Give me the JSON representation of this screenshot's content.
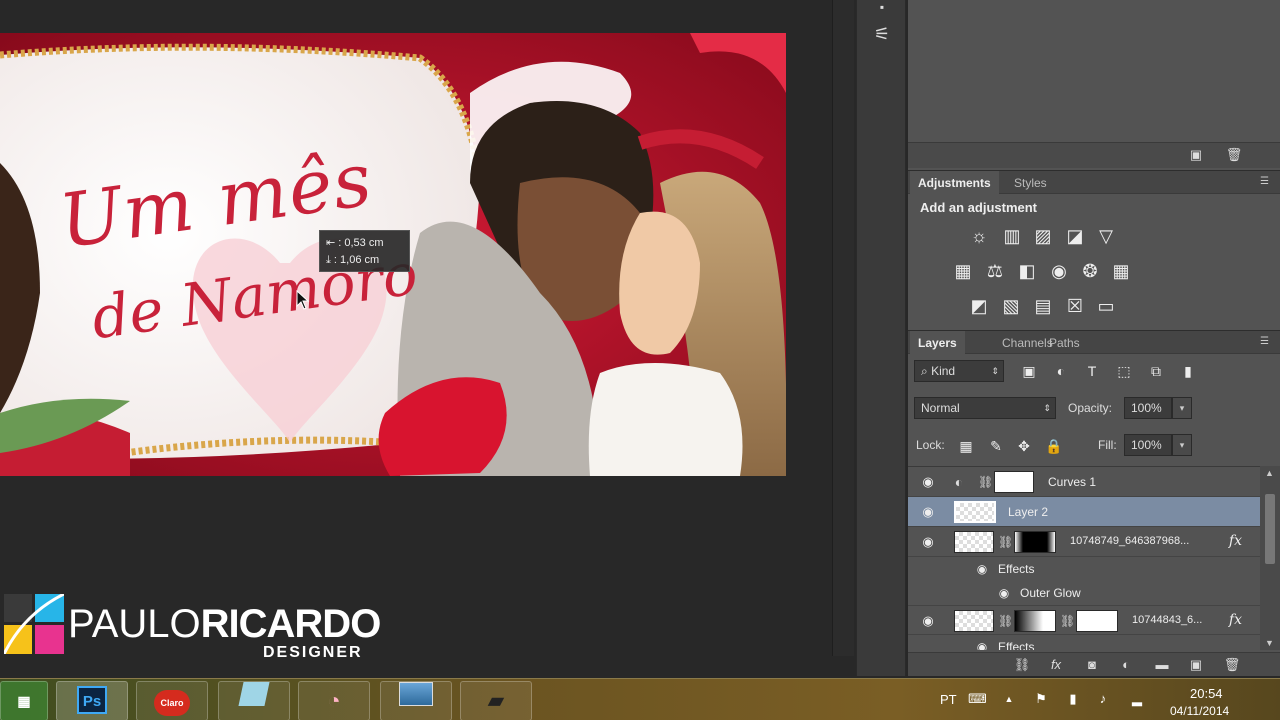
{
  "canvas": {
    "title_line1": "Um mês",
    "title_line2": "de Namoro",
    "measure_tooltip": {
      "horizontal": "⇤ :  0,53 cm",
      "vertical": "⤓ :  1,06 cm"
    }
  },
  "watermark": {
    "name_thin": "PAULO",
    "name_bold": "RICARDO",
    "subtitle": "DESIGNER"
  },
  "adjustments_panel": {
    "tabs": [
      "Adjustments",
      "Styles"
    ],
    "add_label": "Add an adjustment",
    "icons_row1": [
      "brightness-contrast-icon",
      "levels-icon",
      "curves-icon",
      "exposure-icon",
      "vibrance-icon"
    ],
    "icons_row2": [
      "hue-saturation-icon",
      "color-balance-icon",
      "black-white-icon",
      "photo-filter-icon",
      "channel-mixer-icon",
      "color-lookup-icon"
    ],
    "icons_row3": [
      "invert-icon",
      "posterize-icon",
      "threshold-icon",
      "selective-color-icon",
      "gradient-map-icon"
    ]
  },
  "layers_panel": {
    "tabs": [
      "Layers",
      "Channels",
      "Paths"
    ],
    "filter_kind": "Kind",
    "blend_mode": "Normal",
    "opacity_label": "Opacity:",
    "opacity_value": "100%",
    "lock_label": "Lock:",
    "fill_label": "Fill:",
    "fill_value": "100%",
    "layers": {
      "curves": "Curves 1",
      "layer2": "Layer 2",
      "photo1": "10748749_646387968...",
      "photo1_effects": "Effects",
      "photo1_outer_glow": "Outer Glow",
      "photo2": "10744843_6...",
      "photo2_effects": "Effects"
    },
    "fx_label": "fx"
  },
  "taskbar": {
    "apps": [
      "windows-explorer",
      "photoshop",
      "claro",
      "notes",
      "paint",
      "photo-viewer",
      "camera"
    ],
    "ps_label": "Ps",
    "claro_label": "Claro",
    "language": "PT",
    "time": "20:54",
    "date": "04/11/2014"
  }
}
